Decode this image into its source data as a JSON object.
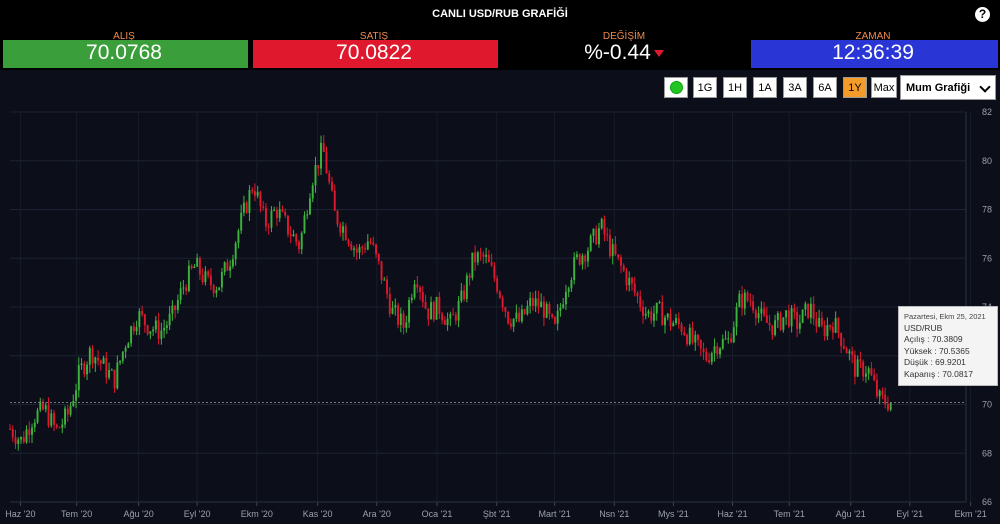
{
  "header": {
    "title": "CANLI USD/RUB GRAFİĞİ",
    "help_icon": "?"
  },
  "stats": {
    "bid": {
      "label": "ALIŞ",
      "value": "70.0768"
    },
    "ask": {
      "label": "SATIŞ",
      "value": "70.0822"
    },
    "change": {
      "label": "DEĞİŞİM",
      "value": "%-0.44"
    },
    "time": {
      "label": "ZAMAN",
      "value": "12:36:39"
    }
  },
  "colors": {
    "bid": "#3a9e3a",
    "ask": "#e0182d",
    "time": "#2a35d6",
    "up": "#3cb43c",
    "down": "#e0182d",
    "active": "#f39c2a"
  },
  "controls": {
    "ranges": [
      "1G",
      "1H",
      "1A",
      "3A",
      "6A",
      "1Y",
      "Max"
    ],
    "active_range": "1Y",
    "chart_type": "Mum Grafiği"
  },
  "tooltip": {
    "date": "Pazartesi, Ekm 25, 2021",
    "symbol": "USD/RUB",
    "open": "Açılış : 70.3809",
    "high": "Yüksek : 70.5365",
    "low": "Düşük : 69.9201",
    "close": "Kapanış : 70.0817"
  },
  "chart_data": {
    "type": "candlestick",
    "ylim": [
      66,
      82
    ],
    "yticks": [
      66,
      68,
      70,
      72,
      74,
      76,
      78,
      80,
      82
    ],
    "crosshair_y": 70.08,
    "x_labels": [
      "Haz '20",
      "Tem '20",
      "Ağu '20",
      "Eyl '20",
      "Ekm '20",
      "Kas '20",
      "Ara '20",
      "Oca '21",
      "Şbt '21",
      "Mart '21",
      "Nsn '21",
      "Mys '21",
      "Haz '21",
      "Tem '21",
      "Ağu '21",
      "Eyl '21",
      "Ekm '21"
    ],
    "x_label_positions": [
      0.018,
      0.115,
      0.222,
      0.323,
      0.426,
      0.531,
      0.633,
      0.737,
      0.84,
      0.94,
      1.043,
      1.145,
      1.247,
      1.345,
      1.451,
      1.553,
      1.658
    ],
    "close_path": [
      [
        0.0,
        69.0
      ],
      [
        0.02,
        68.5
      ],
      [
        0.04,
        69.5
      ],
      [
        0.06,
        69.8
      ],
      [
        0.08,
        68.9
      ],
      [
        0.1,
        69.6
      ],
      [
        0.12,
        71.3
      ],
      [
        0.14,
        72.2
      ],
      [
        0.16,
        71.6
      ],
      [
        0.18,
        71.0
      ],
      [
        0.2,
        72.6
      ],
      [
        0.22,
        73.7
      ],
      [
        0.24,
        73.2
      ],
      [
        0.26,
        73.0
      ],
      [
        0.28,
        73.6
      ],
      [
        0.3,
        74.9
      ],
      [
        0.32,
        75.7
      ],
      [
        0.34,
        75.0
      ],
      [
        0.36,
        74.9
      ],
      [
        0.38,
        76.0
      ],
      [
        0.4,
        77.6
      ],
      [
        0.42,
        79.1
      ],
      [
        0.44,
        77.4
      ],
      [
        0.46,
        78.0
      ],
      [
        0.48,
        77.2
      ],
      [
        0.5,
        76.5
      ],
      [
        0.52,
        79.2
      ],
      [
        0.54,
        80.5
      ],
      [
        0.56,
        77.8
      ],
      [
        0.58,
        77.1
      ],
      [
        0.6,
        76.2
      ],
      [
        0.62,
        76.8
      ],
      [
        0.64,
        75.4
      ],
      [
        0.66,
        73.8
      ],
      [
        0.68,
        73.2
      ],
      [
        0.7,
        75.5
      ],
      [
        0.72,
        73.8
      ],
      [
        0.74,
        74.0
      ],
      [
        0.76,
        73.3
      ],
      [
        0.78,
        74.3
      ],
      [
        0.8,
        76.0
      ],
      [
        0.82,
        76.0
      ],
      [
        0.84,
        75.0
      ],
      [
        0.86,
        73.6
      ],
      [
        0.88,
        73.4
      ],
      [
        0.9,
        74.2
      ],
      [
        0.92,
        74.0
      ],
      [
        0.94,
        73.0
      ],
      [
        0.96,
        75.0
      ],
      [
        0.98,
        76.0
      ],
      [
        1.0,
        76.5
      ],
      [
        1.02,
        77.3
      ],
      [
        1.04,
        76.2
      ],
      [
        1.06,
        75.4
      ],
      [
        1.08,
        74.5
      ],
      [
        1.1,
        73.7
      ],
      [
        1.12,
        73.8
      ],
      [
        1.14,
        73.4
      ],
      [
        1.16,
        73.2
      ],
      [
        1.18,
        72.5
      ],
      [
        1.2,
        71.9
      ],
      [
        1.22,
        72.5
      ],
      [
        1.24,
        72.6
      ],
      [
        1.26,
        74.3
      ],
      [
        1.28,
        74.3
      ],
      [
        1.3,
        73.4
      ],
      [
        1.32,
        73.2
      ],
      [
        1.34,
        73.7
      ],
      [
        1.36,
        73.3
      ],
      [
        1.38,
        74.0
      ],
      [
        1.4,
        73.0
      ],
      [
        1.42,
        73.4
      ],
      [
        1.44,
        72.5
      ],
      [
        1.46,
        71.4
      ],
      [
        1.48,
        71.5
      ],
      [
        1.5,
        70.2
      ],
      [
        1.52,
        70.08
      ]
    ]
  }
}
